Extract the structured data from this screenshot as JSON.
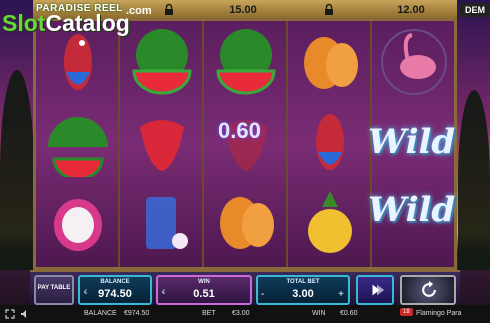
{
  "logo": {
    "small": "PARADISE REEL",
    "main_slot": "Slot",
    "main_catalog": "Catalog",
    "domain": ".com"
  },
  "top_bar": {
    "cost_1": "15.00",
    "cost_2": "12.00",
    "demo": "DEM"
  },
  "reels": {
    "wild_label": "Wild",
    "win_amount": "0.60"
  },
  "panel": {
    "paytable_label": "PAY TABLE",
    "balance_label": "BALANCE",
    "balance_value": "974.50",
    "currency": "€",
    "win_label": "WIN",
    "win_value": "0.51",
    "bet_label": "TOTAL BET",
    "bet_value": "3.00",
    "minus": "-",
    "plus": "+"
  },
  "footer": {
    "balance_label": "BALANCE",
    "balance_value": "€974.50",
    "bet_label": "BET",
    "bet_value": "€3.00",
    "win_label": "WIN",
    "win_value": "€0.60",
    "game_title": "Flamingo Para",
    "rg_badge": "18"
  },
  "colors": {
    "accent": "#3ab8d8",
    "frame": "#8a6a3a",
    "reel_bg": "#7a2c74"
  }
}
